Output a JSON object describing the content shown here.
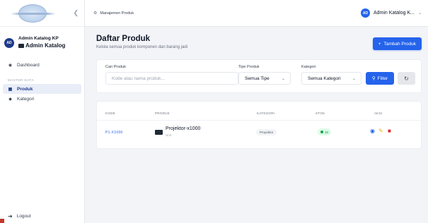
{
  "sidebar": {
    "collapse_icon": "chevron-left-icon",
    "user": {
      "initials": "AD",
      "name": "Admin Katalog KP",
      "role": "Admin Katalog"
    },
    "items": [
      {
        "label": "Dashboard",
        "icon": "gauge-icon"
      },
      {
        "label": "Produk",
        "icon": "box-icon",
        "active": true
      },
      {
        "label": "Kategori",
        "icon": "tag-icon"
      }
    ],
    "section_label": "MASTER DATA",
    "logout_label": "Logout"
  },
  "topbar": {
    "breadcrumb": "Manajemen Produk",
    "user_initials": "AD",
    "user_label": "Admin Katalog K..."
  },
  "page": {
    "title": "Daftar Produk",
    "subtitle": "Kelola semua produk komponen dan barang jadi",
    "add_button": "Tambah Produk"
  },
  "filters": {
    "search_label": "Cari Produk",
    "search_placeholder": "Kode atau nama produk...",
    "type_label": "Tipe Produk",
    "type_value": "Semua Tipe",
    "category_label": "Kategori",
    "category_value": "Semua Kategori",
    "filter_button": "Filter"
  },
  "table": {
    "headers": [
      "KODE",
      "PRODUK",
      "KATEGORI",
      "STOK",
      "AKSI"
    ],
    "rows": [
      {
        "code": "P1-X1000",
        "name": "Projektor-x1000",
        "unit": "Unit",
        "category": "Proyektor",
        "stock": "10"
      }
    ]
  },
  "colors": {
    "accent": "#2563eb",
    "sidebar_active_bg": "#e8edf8",
    "stock_ok": "#16a34a",
    "delete": "#dc2626",
    "edit": "#eab308"
  }
}
